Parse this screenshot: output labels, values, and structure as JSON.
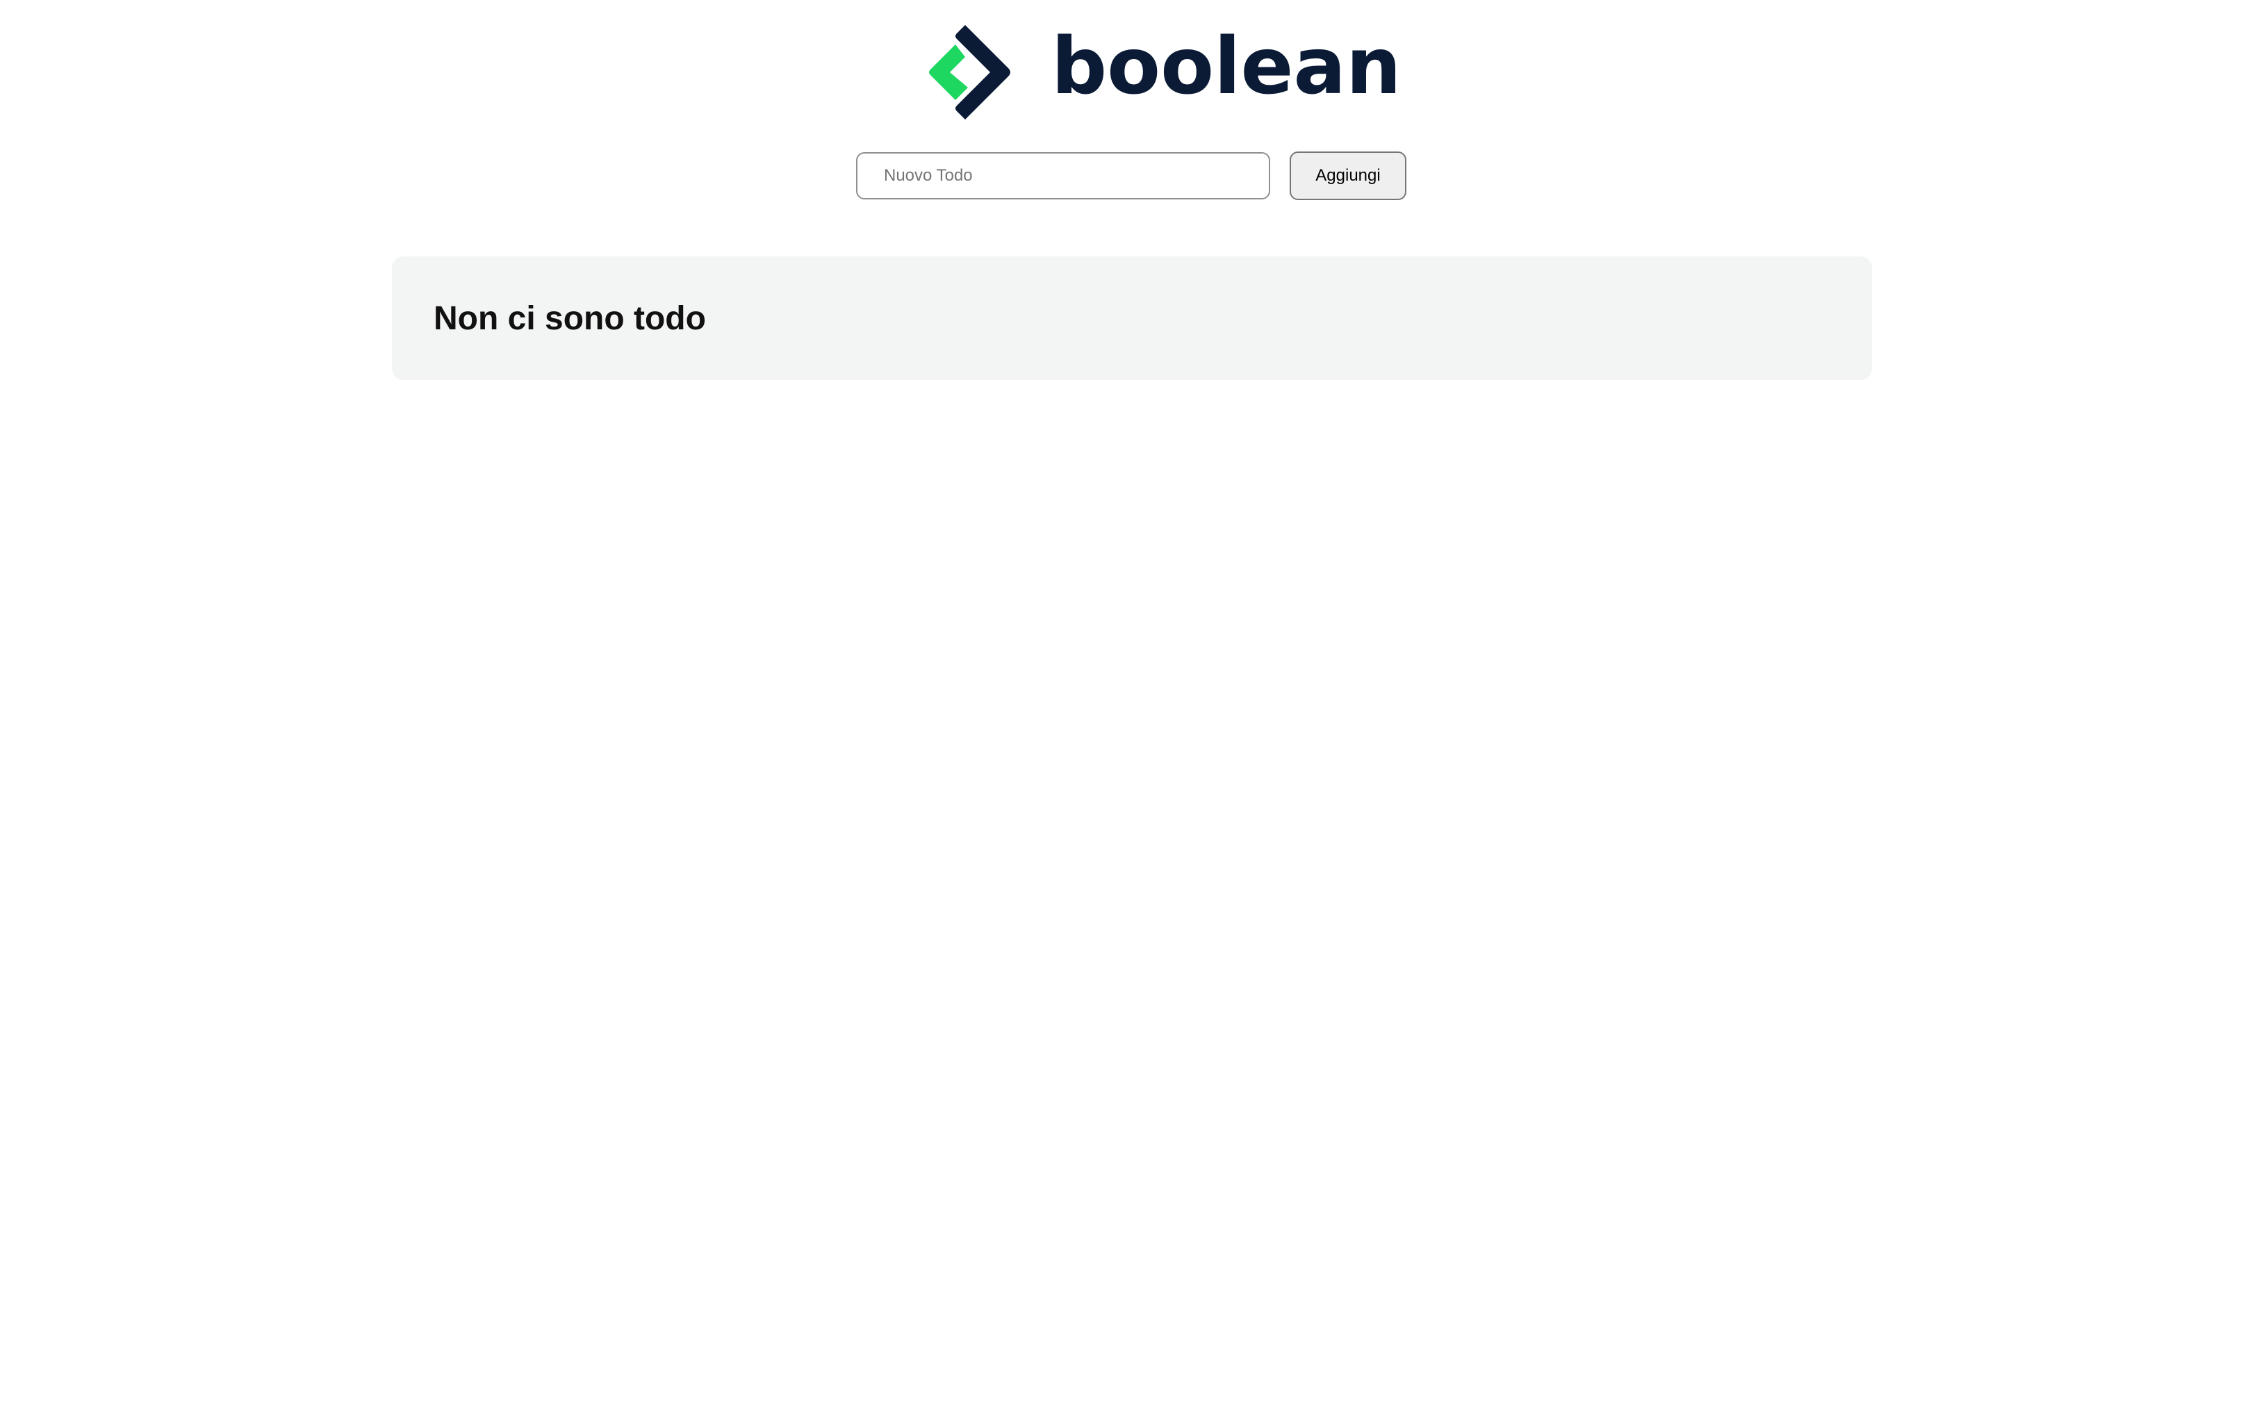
{
  "brand": {
    "name": "boolean",
    "icon": "boolean-logo-icon",
    "colors": {
      "dark": "#0b1b35",
      "green": "#1ed760"
    }
  },
  "form": {
    "input_placeholder": "Nuovo Todo",
    "input_value": "",
    "add_label": "Aggiungi"
  },
  "todos": {
    "items": [],
    "empty_message": "Non ci sono todo"
  }
}
